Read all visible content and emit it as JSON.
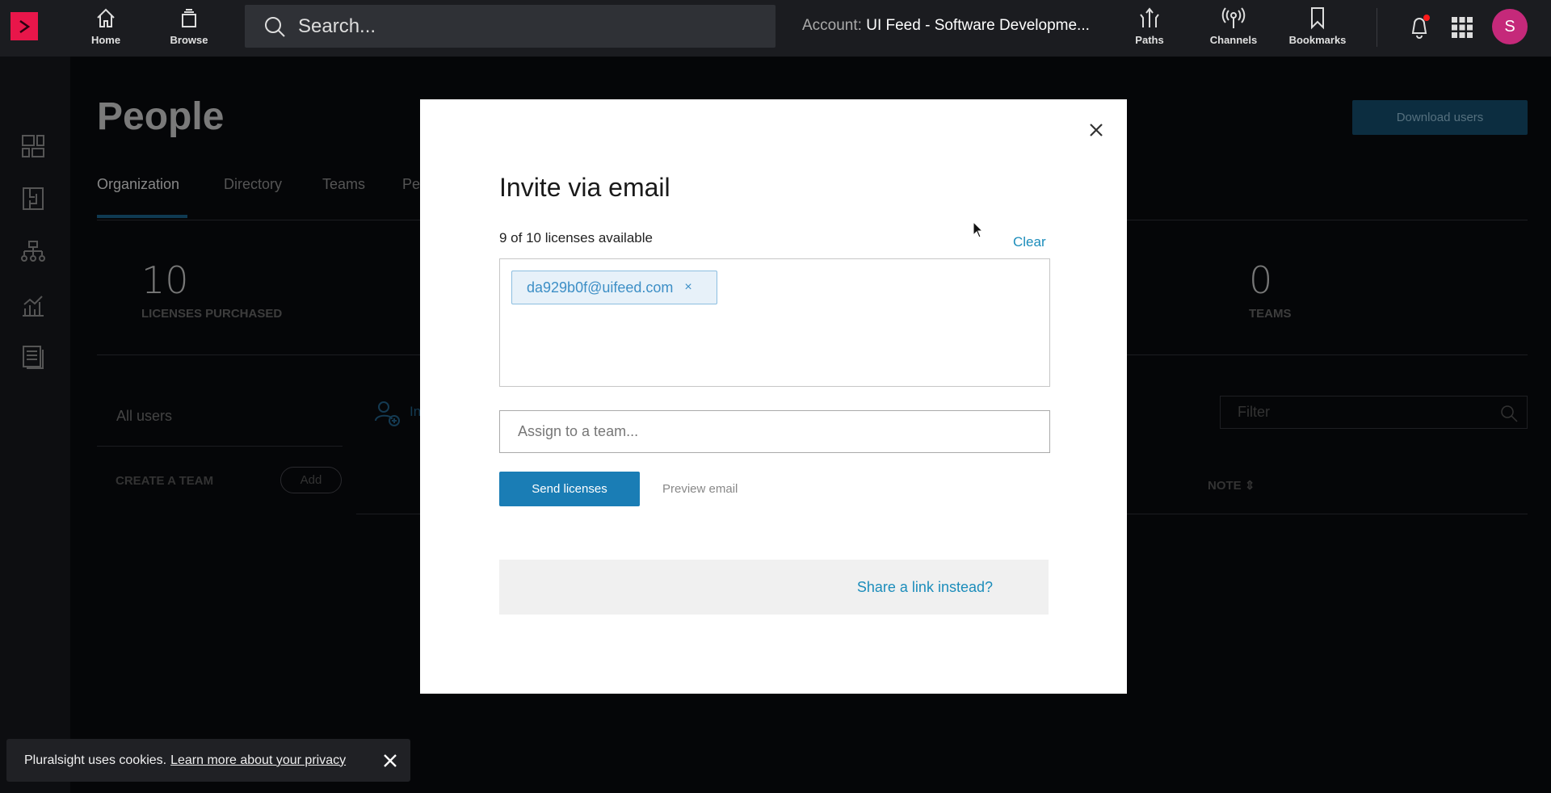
{
  "topbar": {
    "home": "Home",
    "browse": "Browse",
    "search_placeholder": "Search...",
    "account_label": "Account:",
    "account_name": "UI Feed - Software Developme...",
    "paths": "Paths",
    "channels": "Channels",
    "bookmarks": "Bookmarks",
    "avatar_initial": "S",
    "brand_color": "#e8164a",
    "notification_dot_color": "#ff1a1a"
  },
  "page": {
    "title": "People",
    "download_users": "Download users",
    "tabs": [
      "Organization",
      "Directory",
      "Teams",
      "Pe"
    ],
    "active_tab": "Organization",
    "stats": [
      {
        "value": "10",
        "label": "LICENSES PURCHASED"
      },
      {
        "value": "0",
        "label": "TEAMS"
      }
    ],
    "all_users": "All users",
    "create_team": "CREATE A TEAM",
    "add": "Add",
    "invite_partial": "In",
    "filter_placeholder": "Filter",
    "note_column": "NOTE"
  },
  "modal": {
    "title": "Invite via email",
    "licenses_available": "9 of 10 licenses available",
    "clear": "Clear",
    "emails": [
      "da929b0f@uifeed.com"
    ],
    "chip_remove": "×",
    "team_placeholder": "Assign to a team...",
    "send": "Send licenses",
    "preview": "Preview email",
    "share_link": "Share a link instead?",
    "accent_color": "#1a7db5"
  },
  "cookie": {
    "text": "Pluralsight uses cookies.",
    "link": "Learn more about your privacy"
  }
}
